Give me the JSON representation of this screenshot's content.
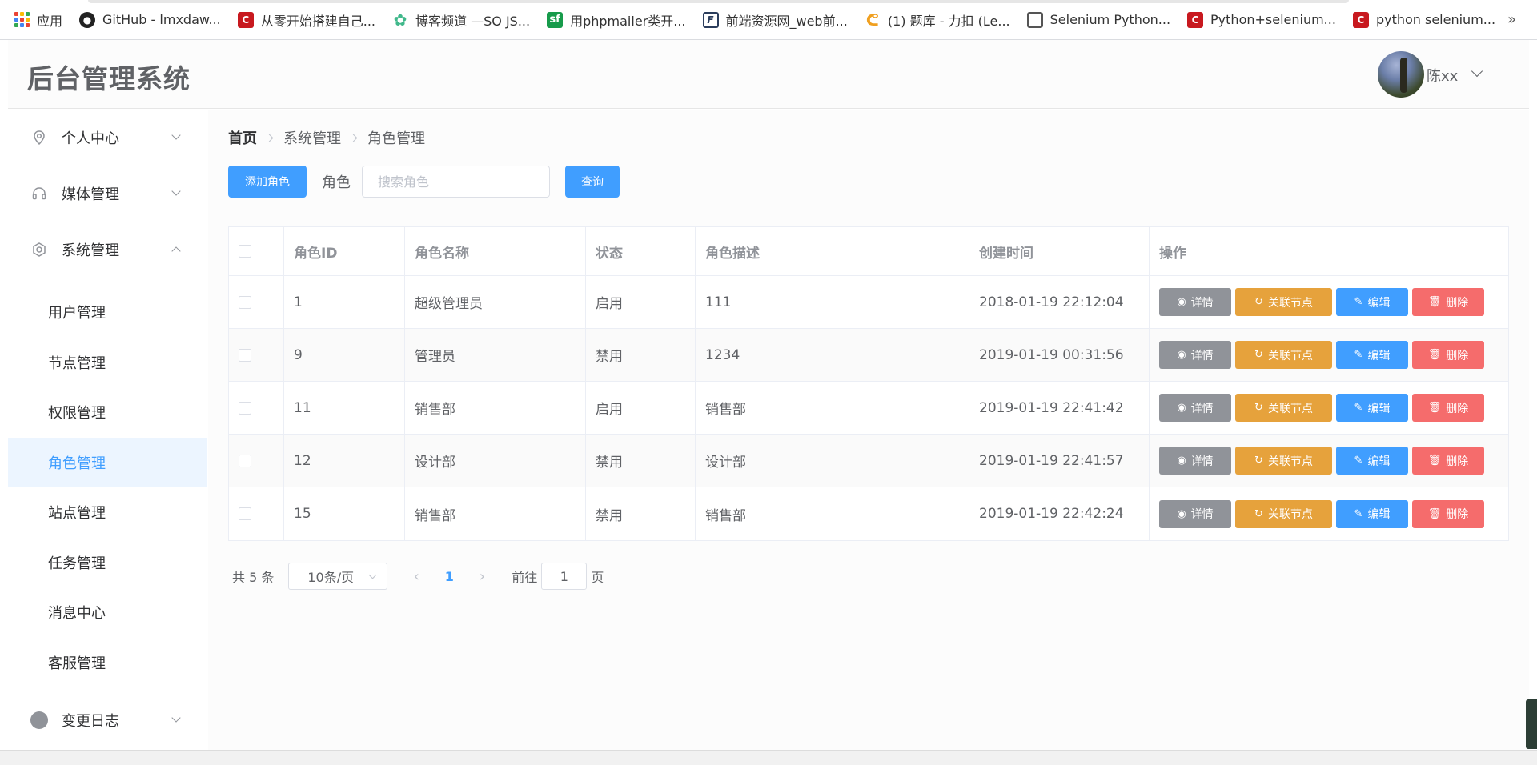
{
  "bookmarks": [
    {
      "label": "应用",
      "icon": "apps-icon"
    },
    {
      "label": "GitHub - lmxdaw...",
      "icon": "github-icon"
    },
    {
      "label": "从零开始搭建自己...",
      "icon": "csdn-icon"
    },
    {
      "label": "博客频道 —SO JS...",
      "icon": "gear-icon"
    },
    {
      "label": "用phpmailer类开...",
      "icon": "segmentfault-icon"
    },
    {
      "label": "前端资源网_web前...",
      "icon": "fy-icon"
    },
    {
      "label": "(1) 题库 - 力扣 (Le...",
      "icon": "leetcode-icon"
    },
    {
      "label": "Selenium Python...",
      "icon": "document-icon"
    },
    {
      "label": "Python+selenium...",
      "icon": "csdn-icon"
    },
    {
      "label": "python selenium...",
      "icon": "csdn-icon"
    }
  ],
  "bookmarks_more": "»",
  "header": {
    "title": "后台管理系统",
    "user_name": "陈xx"
  },
  "sidebar": {
    "menus": [
      {
        "label": "个人中心",
        "icon": "location-icon"
      },
      {
        "label": "媒体管理",
        "icon": "headset-icon"
      },
      {
        "label": "系统管理",
        "icon": "settings-icon"
      }
    ],
    "sub_items": [
      "用户管理",
      "节点管理",
      "权限管理",
      "角色管理",
      "站点管理",
      "任务管理",
      "消息中心",
      "客服管理"
    ],
    "active_sub": "角色管理",
    "log": {
      "label": "变更日志",
      "icon": "info-icon",
      "icon_glyph": "i"
    }
  },
  "breadcrumb": [
    "首页",
    "系统管理",
    "角色管理"
  ],
  "toolbar": {
    "add_label": "添加角色",
    "role_label": "角色",
    "search_placeholder": "搜索角色",
    "query_label": "查询"
  },
  "table": {
    "headers": [
      "角色ID",
      "角色名称",
      "状态",
      "角色描述",
      "创建时间",
      "操作"
    ],
    "rows": [
      {
        "id": "1",
        "name": "超级管理员",
        "status": "启用",
        "desc": "111",
        "created": "2018-01-19 22:12:04"
      },
      {
        "id": "9",
        "name": "管理员",
        "status": "禁用",
        "desc": "1234",
        "created": "2019-01-19 00:31:56"
      },
      {
        "id": "11",
        "name": "销售部",
        "status": "启用",
        "desc": "销售部",
        "created": "2019-01-19 22:41:42"
      },
      {
        "id": "12",
        "name": "设计部",
        "status": "禁用",
        "desc": "设计部",
        "created": "2019-01-19 22:41:57"
      },
      {
        "id": "15",
        "name": "销售部",
        "status": "禁用",
        "desc": "销售部",
        "created": "2019-01-19 22:42:24"
      }
    ],
    "actions": {
      "detail": "详情",
      "link": "关联节点",
      "edit": "编辑",
      "delete": "删除"
    }
  },
  "pagination": {
    "total": "共 5 条",
    "page_size": "10条/页",
    "current": "1",
    "goto_prefix": "前往",
    "goto_value": "1",
    "goto_suffix": "页"
  },
  "colors": {
    "primary": "#409eff",
    "warning": "#e6a23c",
    "danger": "#f56c6c",
    "info": "#909399"
  }
}
